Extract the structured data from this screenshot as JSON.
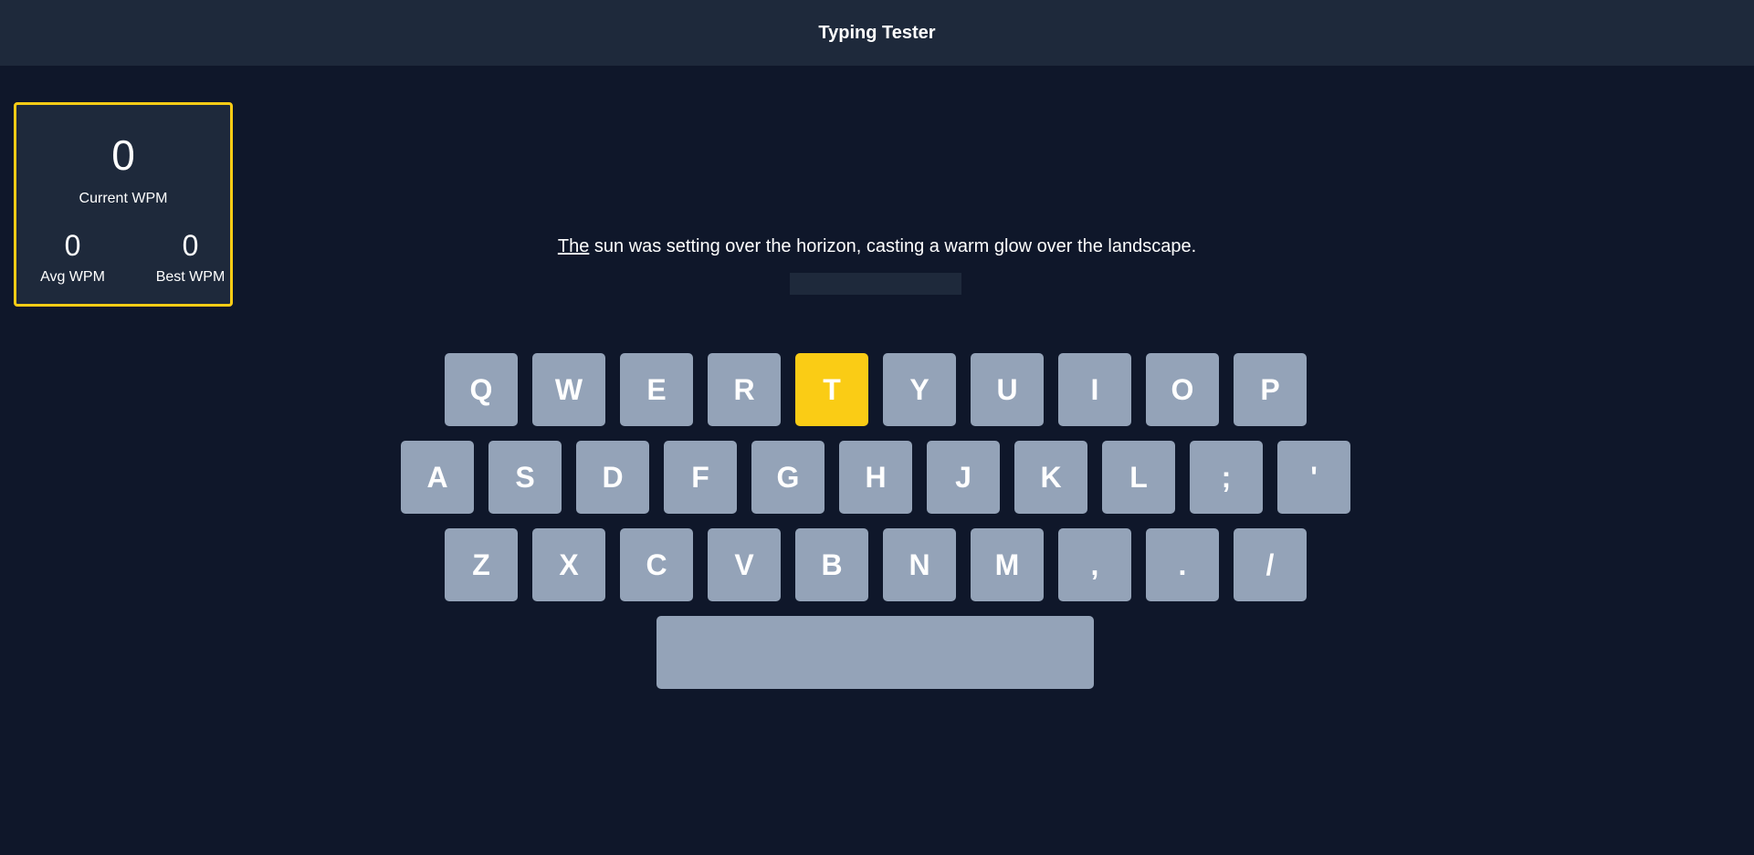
{
  "header": {
    "title": "Typing Tester"
  },
  "stats": {
    "current_wpm": "0",
    "current_label": "Current WPM",
    "avg_wpm": "0",
    "avg_label": "Avg WPM",
    "best_wpm": "0",
    "best_label": "Best WPM"
  },
  "prompt": {
    "current_word": "The",
    "rest": " sun was setting over the horizon, casting a warm glow over the landscape."
  },
  "input": {
    "value": ""
  },
  "keyboard": {
    "row1": [
      "Q",
      "W",
      "E",
      "R",
      "T",
      "Y",
      "U",
      "I",
      "O",
      "P"
    ],
    "row2": [
      "A",
      "S",
      "D",
      "F",
      "G",
      "H",
      "J",
      "K",
      "L",
      ";",
      "'"
    ],
    "row3": [
      "Z",
      "X",
      "C",
      "V",
      "B",
      "N",
      "M",
      ",",
      ".",
      "/"
    ],
    "space": "",
    "active_key": "T"
  },
  "colors": {
    "background": "#0f172a",
    "panel": "#1e293b",
    "accent": "#facc15",
    "key": "#94a3b8"
  }
}
